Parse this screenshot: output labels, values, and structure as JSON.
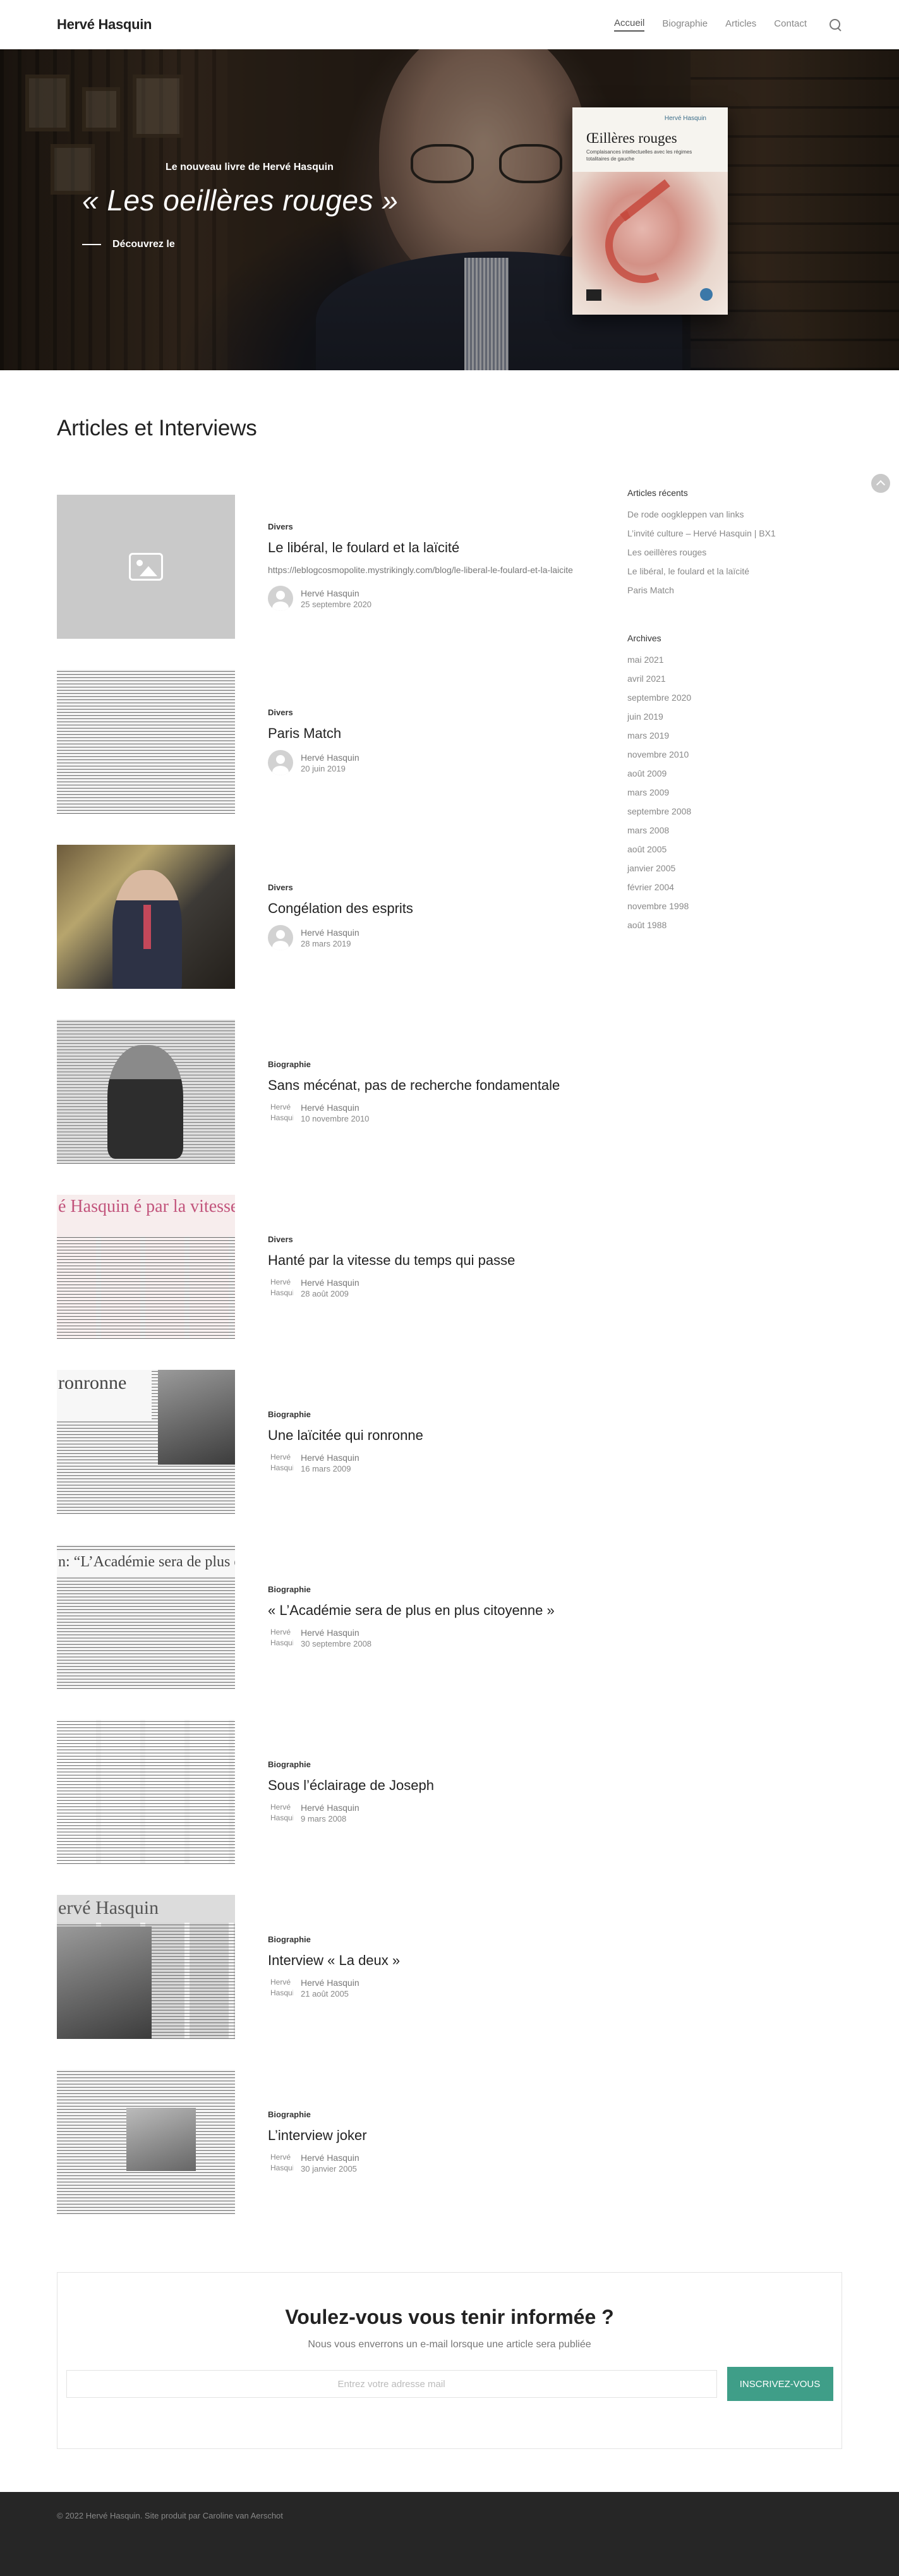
{
  "header": {
    "logo": "Hervé Hasquin",
    "nav": [
      "Accueil",
      "Biographie",
      "Articles",
      "Contact"
    ]
  },
  "hero": {
    "subtitle": "Le nouveau livre de Hervé Hasquin",
    "title": "« Les oeillères rouges »",
    "cta": "Découvrez le",
    "book": {
      "author": "Hervé Hasquin",
      "title": "Œillères rouges",
      "subtitle": "Complaisances intellectuelles avec les régimes totalitaires de gauche"
    }
  },
  "section_title": "Articles et Interviews",
  "articles": [
    {
      "category": "Divers",
      "title": "Le libéral, le foulard et la laïcité",
      "excerpt": "https://leblogcosmopolite.mystrikingly.com/blog/le-liberal-le-foulard-et-la-laicite",
      "author": "Hervé Hasquin",
      "date": "25 septembre 2020"
    },
    {
      "category": "Divers",
      "title": "Paris Match",
      "author": "Hervé Hasquin",
      "date": "20 juin 2019"
    },
    {
      "category": "Divers",
      "title": "Congélation des esprits",
      "author": "Hervé Hasquin",
      "date": "28 mars 2019"
    },
    {
      "category": "Biographie",
      "title": "Sans mécénat, pas de recherche fondamentale",
      "author": "Hervé Hasquin",
      "date": "10 novembre 2010"
    },
    {
      "category": "Divers",
      "title": "Hanté par la vitesse du temps qui passe",
      "author": "Hervé Hasquin",
      "date": "28 août 2009"
    },
    {
      "category": "Biographie",
      "title": "Une laïcitée qui ronronne",
      "author": "Hervé Hasquin",
      "date": "16 mars 2009"
    },
    {
      "category": "Biographie",
      "title": "« L’Académie sera de plus en plus citoyenne »",
      "author": "Hervé Hasquin",
      "date": "30 septembre 2008"
    },
    {
      "category": "Biographie",
      "title": "Sous l’éclairage de Joseph",
      "author": "Hervé Hasquin",
      "date": "9 mars 2008"
    },
    {
      "category": "Biographie",
      "title": "Interview « La deux »",
      "author": "Hervé Hasquin",
      "date": "21 août 2005"
    },
    {
      "category": "Biographie",
      "title": "L’interview joker",
      "author": "Hervé Hasquin",
      "date": "30 janvier 2005"
    }
  ],
  "thumb_text": {
    "hante": "é Hasquin é par la vitesse du temps qui",
    "ronronne": "ronronne",
    "academie": "n: “L’Académie sera de plus en plu",
    "interview": "ervé Hasquin"
  },
  "avatar_alt": "Hervé Hasquin",
  "sidebar": {
    "recent_title": "Articles récents",
    "recent": [
      "De rode oogkleppen van links",
      "L’invité culture – Hervé Hasquin | BX1",
      "Les oeillères rouges",
      "Le libéral, le foulard et la laïcité",
      "Paris Match"
    ],
    "archives_title": "Archives",
    "archives": [
      "mai 2021",
      "avril 2021",
      "septembre 2020",
      "juin 2019",
      "mars 2019",
      "novembre 2010",
      "août 2009",
      "mars 2009",
      "septembre 2008",
      "mars 2008",
      "août 2005",
      "janvier 2005",
      "février 2004",
      "novembre 1998",
      "août 1988"
    ]
  },
  "newsletter": {
    "title": "Voulez-vous vous tenir informée ?",
    "subtitle": "Nous vous enverrons un e-mail lorsque une article sera publiée",
    "placeholder": "Entrez votre adresse mail",
    "button": "INSCRIVEZ-VOUS"
  },
  "footer": "© 2022 Hervé Hasquin. Site produit par Caroline van Aerschot"
}
